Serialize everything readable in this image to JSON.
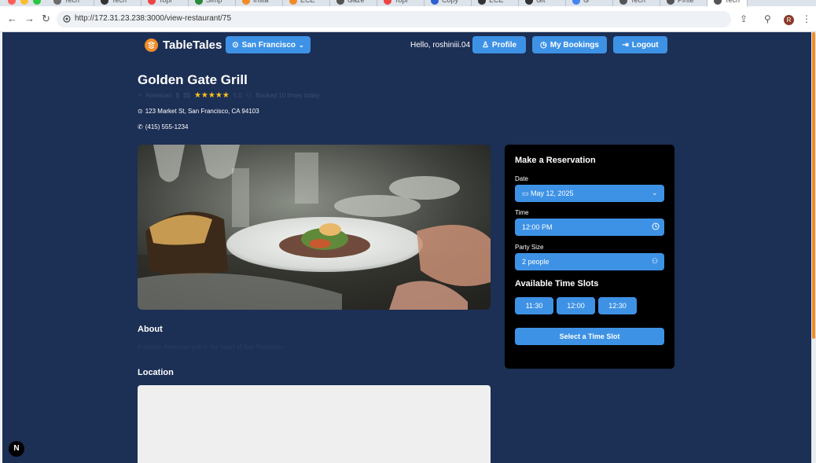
{
  "browser": {
    "url": "http://172.31.23.238:3000/view-restaurant/75",
    "tabs": [
      "Tech",
      "Tech",
      "Topi",
      "Simp",
      "Insta",
      "ECE",
      "Gaze",
      "Topi",
      "Copy",
      "ECE",
      "Git",
      "G",
      "Tech",
      "Pinte",
      "Tech"
    ],
    "avatar_initial": "R"
  },
  "header": {
    "brand": "TableTales",
    "city": "San Francisco",
    "greeting": "Hello, roshiniii.04",
    "profile_label": "Profile",
    "bookings_label": "My Bookings",
    "logout_label": "Logout"
  },
  "restaurant": {
    "name": "Golden Gate Grill",
    "cuisine": "American",
    "price": "$$",
    "stars": "★★★★★",
    "rating": "5.0",
    "booked": "Booked 10 times today",
    "address": "123 Market St, San Francisco, CA 94103",
    "phone": "(415) 555-1234"
  },
  "about": {
    "heading": "About",
    "text": "A classic American grill in the heart of San Francisco"
  },
  "location": {
    "heading": "Location"
  },
  "reservation": {
    "title": "Make a Reservation",
    "date_label": "Date",
    "date_value": "May 12, 2025",
    "time_label": "Time",
    "time_value": "12:00 PM",
    "party_label": "Party Size",
    "party_value": "2 people",
    "slots_heading": "Available Time Slots",
    "slots": [
      "11:30",
      "12:00",
      "12:30"
    ],
    "select_label": "Select a Time Slot"
  },
  "badge": "N",
  "colors": {
    "background": "#1c2f55",
    "accent": "#3e92e5",
    "brand": "#f28c28",
    "star": "#ffc21c"
  }
}
